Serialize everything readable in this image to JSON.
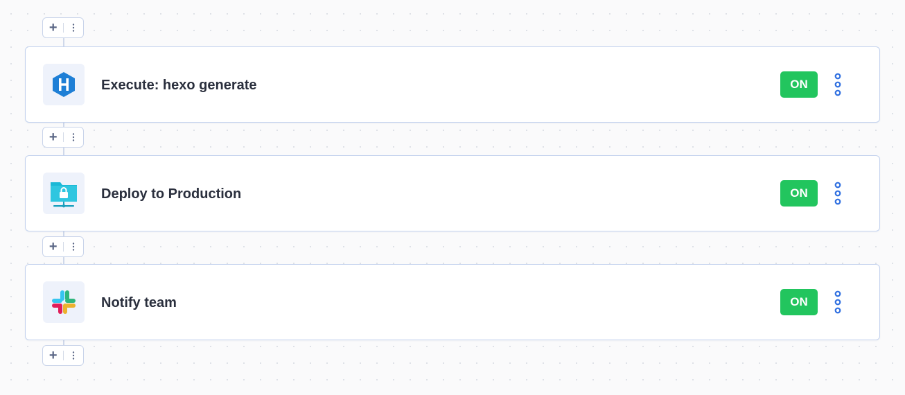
{
  "workflow": {
    "steps": [
      {
        "title": "Execute: hexo generate",
        "icon": "hexo-icon",
        "toggle_label": "ON",
        "enabled": true
      },
      {
        "title": "Deploy to Production",
        "icon": "sftp-server-icon",
        "toggle_label": "ON",
        "enabled": true
      },
      {
        "title": "Notify team",
        "icon": "slack-icon",
        "toggle_label": "ON",
        "enabled": true
      }
    ],
    "add_step_icon": "plus-icon",
    "more_icon": "vertical-dots-icon"
  },
  "colors": {
    "background": "#fafafb",
    "card_border": "#c3d2ee",
    "toggle_on": "#22c55e",
    "menu_dots": "#2f6fe0",
    "hexo_blue": "#1e7fd6",
    "sftp_cyan": "#1ab8d6"
  }
}
